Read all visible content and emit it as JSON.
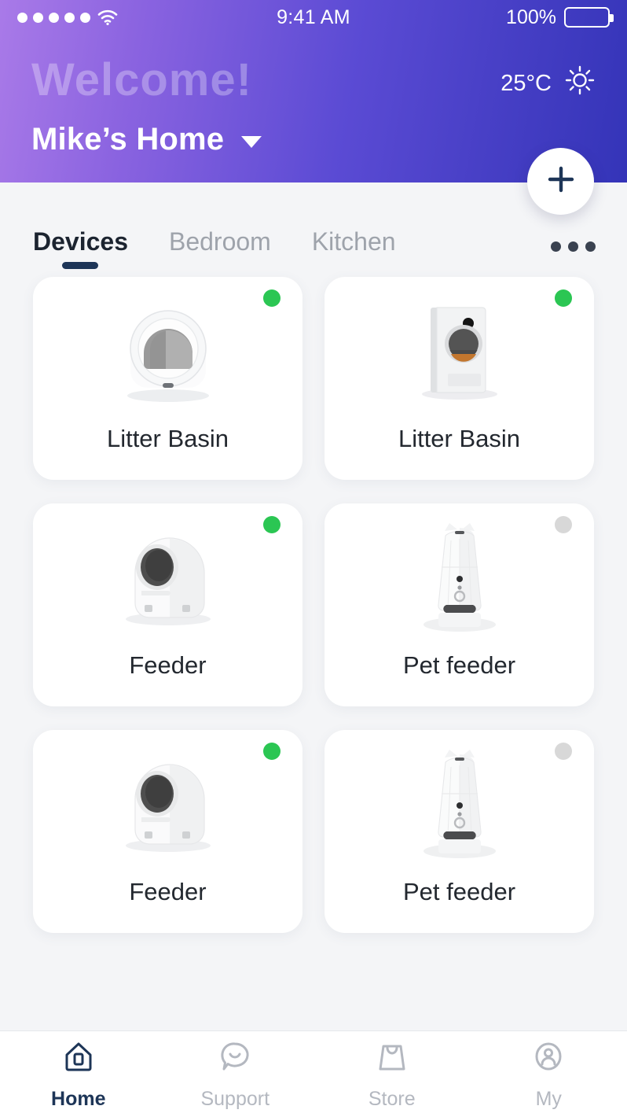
{
  "statusbar": {
    "signal_icon": "signal-dots-icon",
    "wifi_icon": "wifi-icon",
    "time": "9:41 AM",
    "battery_percent": "100%",
    "battery_icon": "battery-full-icon"
  },
  "header": {
    "watermark": "Welcome!",
    "temperature": "25°C",
    "weather_icon": "sun-icon",
    "home_name": "Mike’s Home",
    "dropdown_icon": "chevron-down-icon",
    "add_icon": "plus-icon",
    "gradient_from": "#a97ae8",
    "gradient_to": "#3434b8"
  },
  "tabs": {
    "items": [
      {
        "label": "Devices",
        "active": true
      },
      {
        "label": "Bedroom",
        "active": false
      },
      {
        "label": "Kitchen",
        "active": false
      }
    ],
    "overflow_icon": "more-horizontal-icon",
    "active_color": "#1d3557"
  },
  "devices": [
    {
      "name": "Litter Basin",
      "status": "online",
      "art": "litter-globe",
      "dot_color": "#2bc653"
    },
    {
      "name": "Litter Basin",
      "status": "online",
      "art": "litter-box",
      "dot_color": "#2bc653"
    },
    {
      "name": "Feeder",
      "status": "online",
      "art": "dome-feeder",
      "dot_color": "#2bc653"
    },
    {
      "name": "Pet feeder",
      "status": "offline",
      "art": "tower-feeder",
      "dot_color": "#d8d8d8"
    },
    {
      "name": "Feeder",
      "status": "online",
      "art": "dome-feeder",
      "dot_color": "#2bc653"
    },
    {
      "name": "Pet feeder",
      "status": "offline",
      "art": "tower-feeder",
      "dot_color": "#d8d8d8"
    }
  ],
  "bottomnav": {
    "items": [
      {
        "label": "Home",
        "icon": "house-icon",
        "active": true
      },
      {
        "label": "Support",
        "icon": "speech-bubble-icon",
        "active": false
      },
      {
        "label": "Store",
        "icon": "shopping-bag-icon",
        "active": false
      },
      {
        "label": "My",
        "icon": "user-circle-icon",
        "active": false
      }
    ]
  }
}
